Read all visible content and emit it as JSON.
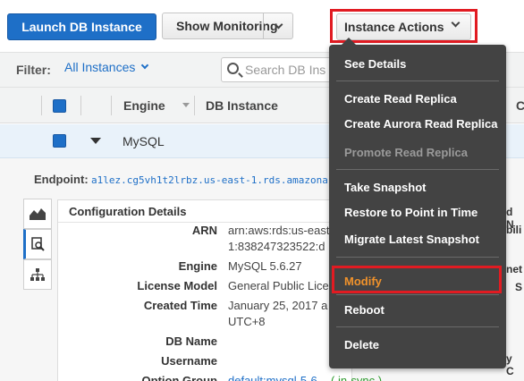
{
  "toolbar": {
    "launch_label": "Launch DB Instance",
    "monitoring_label": "Show Monitoring",
    "actions_label": "Instance Actions"
  },
  "filter": {
    "label": "Filter:",
    "value": "All Instances",
    "search_placeholder": "Search DB Ins"
  },
  "table": {
    "columns": [
      "Engine",
      "DB Instance"
    ],
    "right_partial_header": "C",
    "row": {
      "engine": "MySQL"
    }
  },
  "detail": {
    "endpoint_label": "Endpoint:",
    "endpoint_value": "a1lez.cg5vh1t2lrbz.us-east-1.rds.amazona",
    "panel_title": "Configuration Details",
    "fields": {
      "arn_key": "ARN",
      "arn_val_1": "arn:aws:rds:us-east-",
      "arn_val_2": "1:838247323522:d",
      "engine_key": "Engine",
      "engine_val": "MySQL 5.6.27",
      "license_key": "License Model",
      "license_val": "General Public Lice",
      "created_key": "Created Time",
      "created_val_1": "January 25, 2017 a",
      "created_val_2": "UTC+8",
      "dbname_key": "DB Name",
      "username_key": "Username",
      "optiongroup_key": "Option Group",
      "optiongroup_val": "default:mysql-5-6",
      "optiongroup_status": "( in-sync )"
    },
    "right_partial": [
      "d N",
      "bili",
      "net",
      "S",
      "y C"
    ]
  },
  "menu": {
    "items": [
      "See Details",
      "Create Read Replica",
      "Create Aurora Read Replica",
      "Promote Read Replica",
      "Take Snapshot",
      "Restore to Point in Time",
      "Migrate Latest Snapshot",
      "Modify",
      "Reboot",
      "Delete"
    ]
  },
  "colors": {
    "primary": "#1e6fc7",
    "highlight_box": "#e11b22",
    "menu_bg": "#434343",
    "modify_text": "#f0922b"
  }
}
